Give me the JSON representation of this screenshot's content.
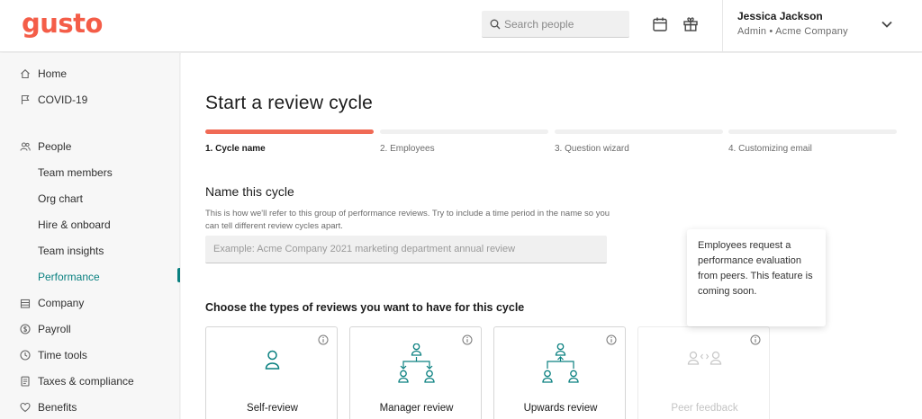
{
  "header": {
    "logo": "gusto",
    "search_placeholder": "Search people",
    "user_name": "Jessica Jackson",
    "user_role": "Admin • Acme Company",
    "icons": [
      "calendar-icon",
      "gift-icon",
      "chevron-down-icon"
    ]
  },
  "sidebar": {
    "items": [
      {
        "label": "Home",
        "icon": "home-icon"
      },
      {
        "label": "COVID-19",
        "icon": "flag-icon"
      },
      {
        "label": "People",
        "icon": "people-icon"
      },
      {
        "label": "Team members"
      },
      {
        "label": "Org chart"
      },
      {
        "label": "Hire & onboard"
      },
      {
        "label": "Team insights"
      },
      {
        "label": "Performance",
        "active": true
      },
      {
        "label": "Company",
        "icon": "building-icon"
      },
      {
        "label": "Payroll",
        "icon": "dollar-icon"
      },
      {
        "label": "Time tools",
        "icon": "clock-icon"
      },
      {
        "label": "Taxes & compliance",
        "icon": "document-icon"
      },
      {
        "label": "Benefits",
        "icon": "heart-icon"
      }
    ],
    "accent_color": "#0a8080"
  },
  "main": {
    "title": "Start a review cycle",
    "steps": [
      {
        "label": "1. Cycle name",
        "status": "current"
      },
      {
        "label": "2. Employees",
        "status": "upcoming"
      },
      {
        "label": "3. Question wizard",
        "status": "upcoming"
      },
      {
        "label": "4. Customizing email",
        "status": "upcoming"
      }
    ],
    "progress_color": "#f06a55",
    "name_section": {
      "title": "Name this cycle",
      "help": "This is how we'll refer to this group of performance reviews. Try to include a time period in the name so you can tell different review cycles apart.",
      "placeholder": "Example: Acme Company 2021 marketing department annual review",
      "value": ""
    },
    "types_title": "Choose the types of reviews you want to have for this cycle",
    "review_types": [
      {
        "label": "Self-review",
        "enabled": true
      },
      {
        "label": "Manager review",
        "enabled": true
      },
      {
        "label": "Upwards review",
        "enabled": true
      },
      {
        "label": "Peer feedback",
        "enabled": false
      }
    ],
    "tooltip": "Employees request a performance evaluation from peers. This feature is coming soon."
  }
}
